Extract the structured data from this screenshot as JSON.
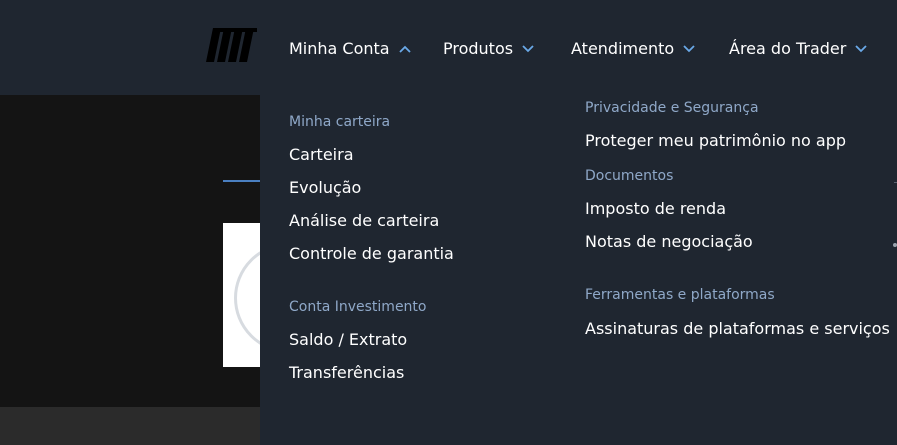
{
  "header": {
    "logo_icon": "brand-logo",
    "nav": [
      {
        "label": "Minha Conta",
        "chevron": "up"
      },
      {
        "label": "Produtos",
        "chevron": "down"
      },
      {
        "label": "Atendimento",
        "chevron": "down"
      },
      {
        "label": "Área do Trader",
        "chevron": "down"
      }
    ]
  },
  "dropdown": {
    "left_column": [
      {
        "title": "Minha carteira",
        "links": [
          "Carteira",
          "Evolução",
          "Análise de carteira",
          "Controle de garantia"
        ]
      },
      {
        "title": "Conta Investimento",
        "links": [
          "Saldo / Extrato",
          "Transferências"
        ]
      }
    ],
    "right_column": [
      {
        "title": "Privacidade e Segurança",
        "links": [
          "Proteger meu patrimônio no app"
        ]
      },
      {
        "title": "Documentos",
        "links": [
          "Imposto de renda",
          "Notas de negociação"
        ]
      },
      {
        "title": "Ferramentas e plataformas",
        "links": [
          "Assinaturas de plataformas e serviços"
        ]
      }
    ]
  },
  "colors": {
    "header_bg": "#1f2630",
    "section_title": "#8fa8c8",
    "link_text": "#ffffff",
    "chevron": "#6aa9e8",
    "page_bg": "#141414"
  }
}
